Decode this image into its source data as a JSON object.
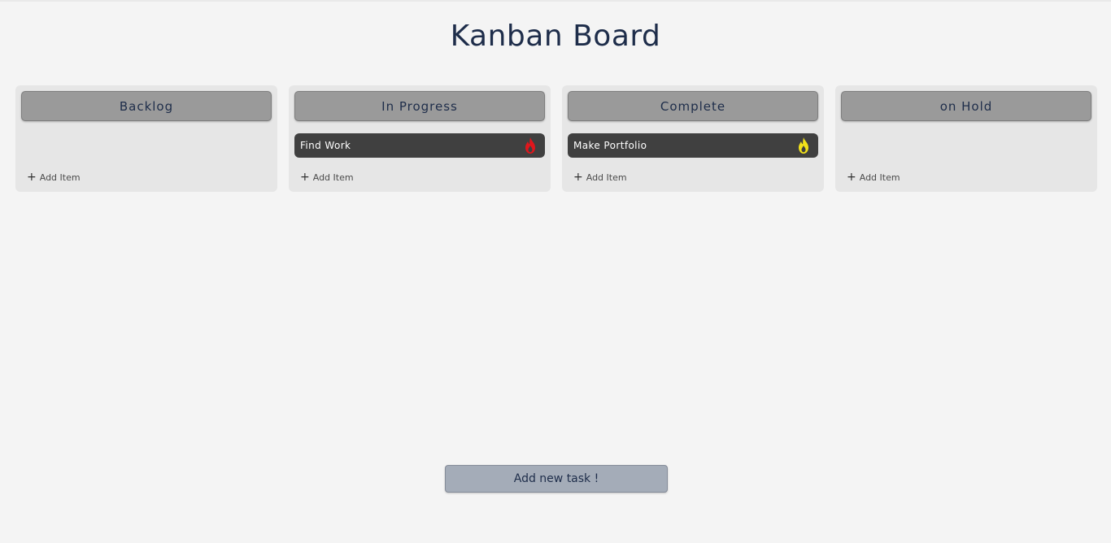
{
  "page": {
    "title": "Kanban Board"
  },
  "columns": [
    {
      "header": "Backlog",
      "cards": [],
      "add_item_label": "Add Item"
    },
    {
      "header": "In Progress",
      "cards": [
        {
          "label": "Find Work",
          "icon": "flame-icon",
          "icon_color": "#e0161c"
        }
      ],
      "add_item_label": "Add Item"
    },
    {
      "header": "Complete",
      "cards": [
        {
          "label": "Make Portfolio",
          "icon": "flame-icon",
          "icon_color": "#f2e21a"
        }
      ],
      "add_item_label": "Add Item"
    },
    {
      "header": "on Hold",
      "cards": [],
      "add_item_label": "Add Item"
    }
  ],
  "add_item_icon": "plus-icon",
  "footer": {
    "add_task_label": "Add new task !"
  },
  "colors": {
    "background": "#f4f4f4",
    "column_bg": "#e6e6e6",
    "header_bg": "#9a9a9a",
    "card_bg": "#404040",
    "title_color": "#1e2d4a",
    "add_task_bg": "#a4acb8"
  }
}
